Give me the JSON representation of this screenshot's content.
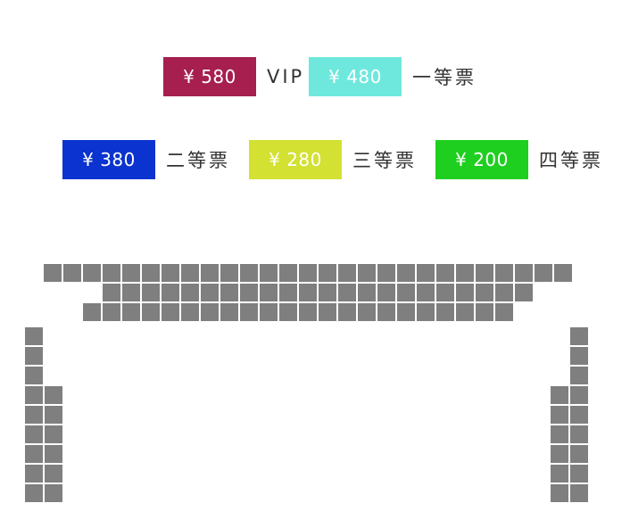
{
  "colors": {
    "seat": "#7f7f7f",
    "text": "#333333",
    "price_text": "#ffffff"
  },
  "legend": {
    "items": [
      {
        "price": "¥ 580",
        "label": "VIP",
        "color": "#a61f4f"
      },
      {
        "price": "¥ 480",
        "label": "一等票",
        "color": "#6ee8dc"
      },
      {
        "price": "¥ 380",
        "label": "二等票",
        "color": "#0b33cf"
      },
      {
        "price": "¥ 280",
        "label": "三等票",
        "color": "#d3e132"
      },
      {
        "price": "¥ 200",
        "label": "四等票",
        "color": "#1fcf1f"
      }
    ]
  },
  "seating": {
    "rows": [
      {
        "seat_count": 27,
        "status": "unavailable"
      },
      {
        "seat_count": 22,
        "status": "unavailable"
      },
      {
        "seat_count": 22,
        "status": "unavailable"
      }
    ],
    "left_side": {
      "columns": 2,
      "rows": 9,
      "status": "unavailable"
    },
    "right_side": {
      "columns": 2,
      "rows": 9,
      "status": "unavailable"
    }
  }
}
